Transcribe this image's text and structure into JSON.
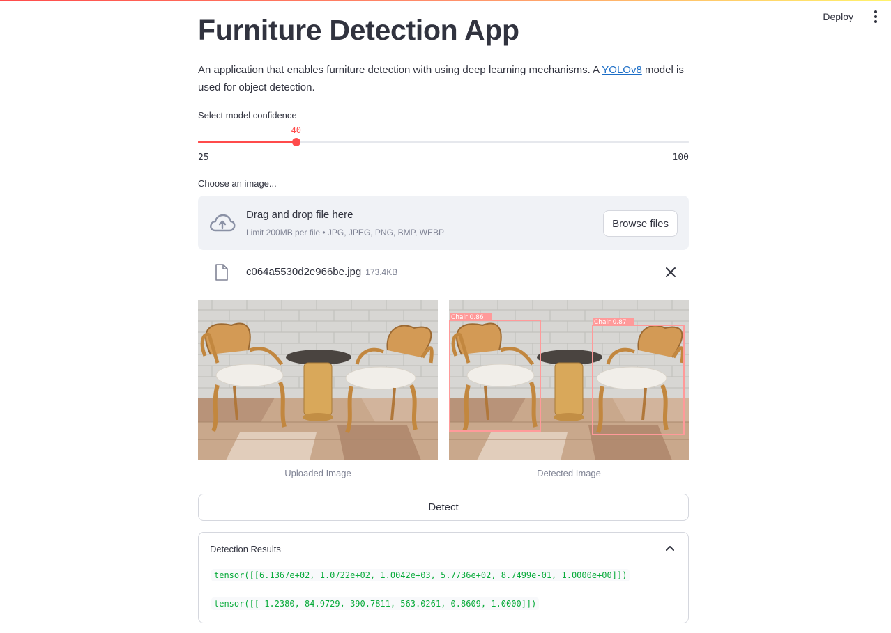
{
  "header": {
    "deploy_label": "Deploy",
    "menu_icon": "vertical-ellipsis-icon"
  },
  "page": {
    "title": "Furniture Detection App",
    "description_before": "An application that enables furniture detection with using deep learning mechanisms. A ",
    "description_link": "YOLOv8",
    "description_after": " model is used for object detection."
  },
  "slider": {
    "label": "Select model confidence",
    "value": 40,
    "min": 25,
    "max": 100,
    "value_text": "40",
    "min_text": "25",
    "max_text": "100",
    "accent_color": "#ff4b4b"
  },
  "uploader": {
    "label": "Choose an image...",
    "drag_text": "Drag and drop file here",
    "limit_text": "Limit 200MB per file • JPG, JPEG, PNG, BMP, WEBP",
    "browse_label": "Browse files",
    "icon": "cloud-upload-icon"
  },
  "file": {
    "name": "c064a5530d2e966be.jpg",
    "size": "173.4KB",
    "icon": "file-icon",
    "remove_icon": "close-icon"
  },
  "images": {
    "uploaded_caption": "Uploaded Image",
    "detected_caption": "Detected Image",
    "detections": [
      {
        "label": "Chair 0.86"
      },
      {
        "label": "Chair 0.87"
      }
    ]
  },
  "detect_button": {
    "label": "Detect"
  },
  "results": {
    "title": "Detection Results",
    "lines": [
      "tensor([[6.1367e+02, 1.0722e+02, 1.0042e+03, 5.7736e+02, 8.7499e-01, 1.0000e+00]])",
      "tensor([[ 1.2380, 84.9729, 390.7811, 563.0261, 0.8609, 1.0000]])"
    ],
    "code_color": "#09ab3b"
  }
}
